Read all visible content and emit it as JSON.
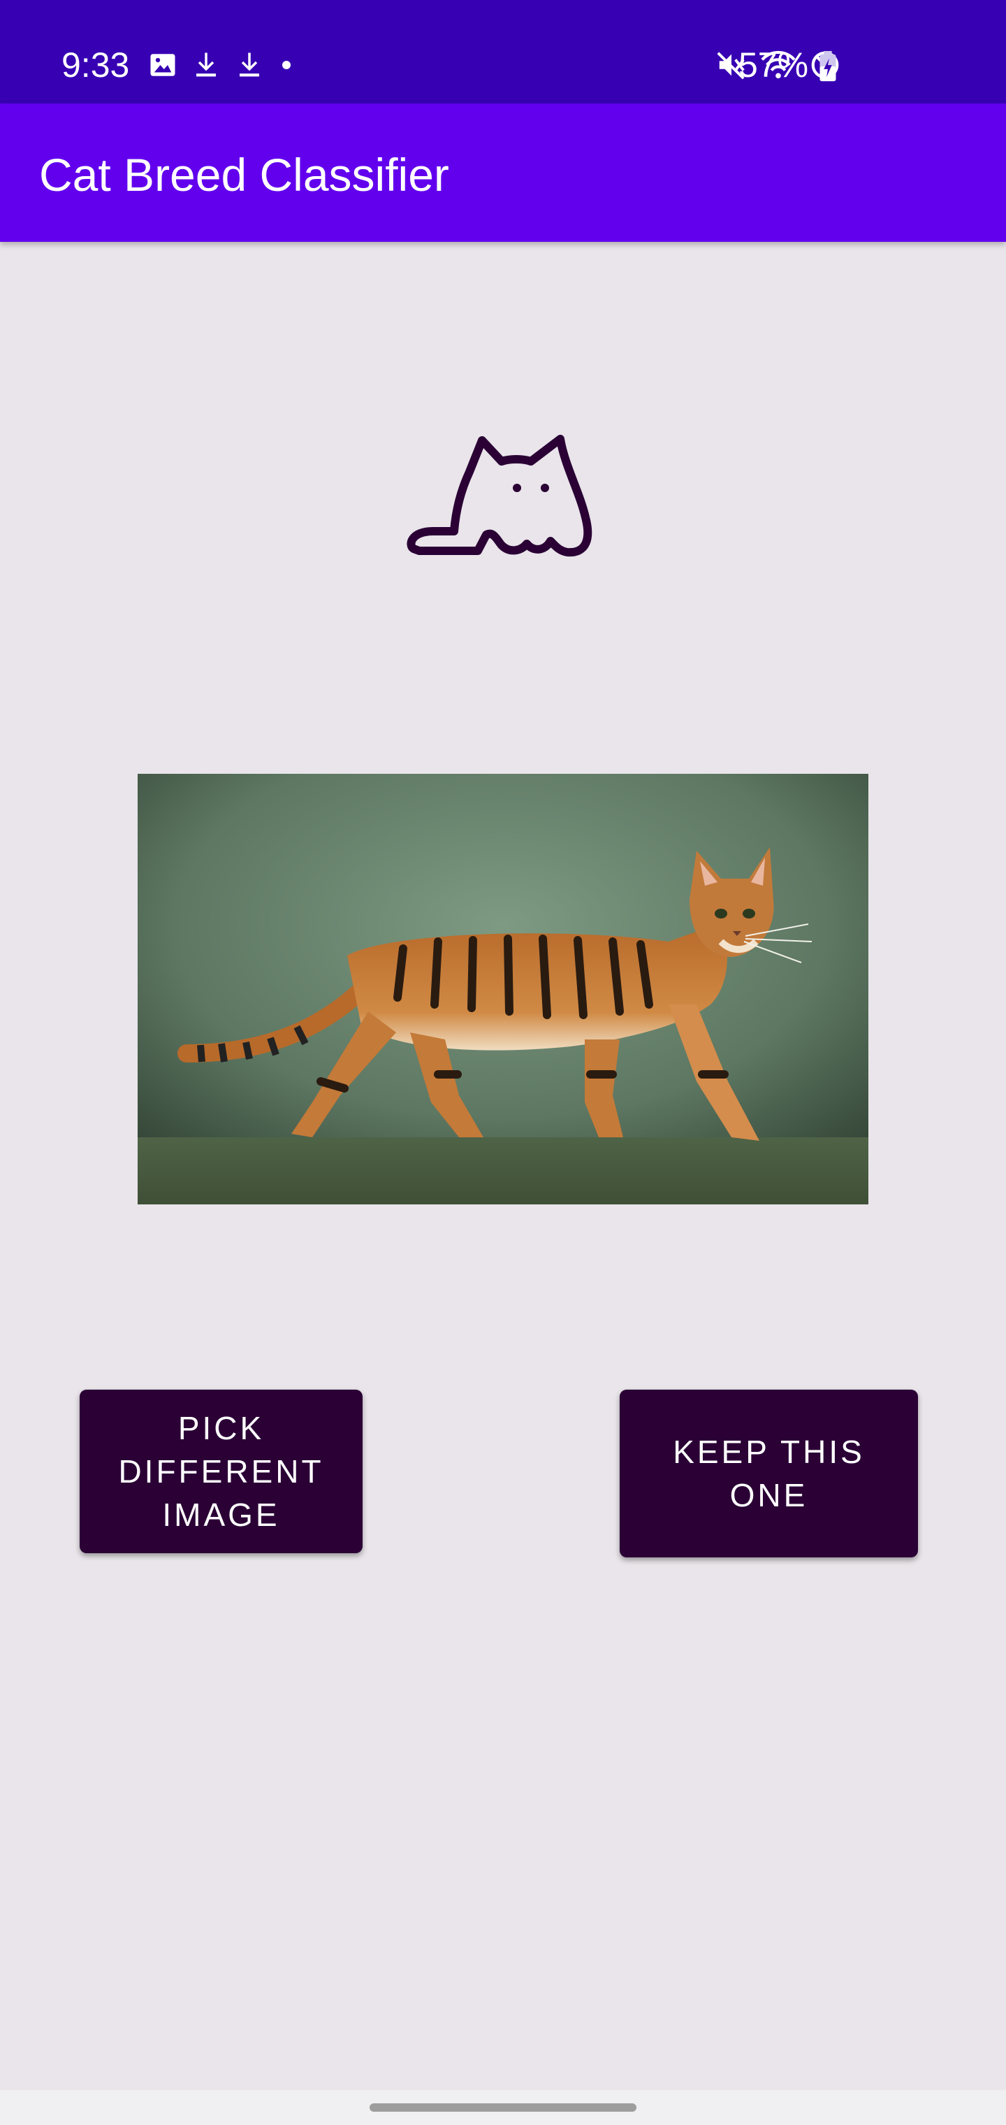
{
  "status_bar": {
    "time": "9:33",
    "battery_percent": "57%",
    "left_icons": [
      "image-icon",
      "download-icon",
      "download-icon",
      "dot-icon"
    ],
    "right_icons": [
      "mute-icon",
      "wifi-icon",
      "do-not-disturb-icon",
      "battery-charging-icon"
    ],
    "background": "#3700b3"
  },
  "app_bar": {
    "title": "Cat Breed Classifier",
    "background": "#6200ee"
  },
  "logo": {
    "icon": "cat-logo-icon",
    "color": "#2a0035"
  },
  "photo": {
    "subject": "tabby-cat-photo"
  },
  "actions": {
    "pick_label": "PICK DIFFERENT IMAGE",
    "keep_label": "KEEP THIS ONE",
    "button_color": "#2a0035"
  }
}
